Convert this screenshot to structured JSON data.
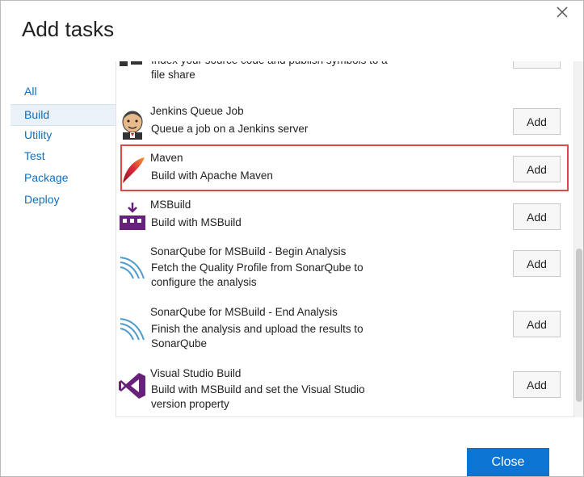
{
  "dialog": {
    "title": "Add tasks",
    "close_label": "Close"
  },
  "sidebar": {
    "items": [
      {
        "label": "All"
      },
      {
        "label": "Build",
        "selected": true
      },
      {
        "label": "Utility"
      },
      {
        "label": "Test"
      },
      {
        "label": "Package"
      },
      {
        "label": "Deploy"
      }
    ]
  },
  "tasks": [
    {
      "name": "",
      "description": "Index your source code and publish symbols to a file share",
      "description_lines": [
        "Index your source code and publish symbols to a",
        "file share"
      ],
      "icon": "index-sources-icon",
      "add_label": "Add"
    },
    {
      "name": "Jenkins Queue Job",
      "description": "Queue a job on a Jenkins server",
      "icon": "jenkins-icon",
      "add_label": "Add"
    },
    {
      "name": "Maven",
      "description": "Build with Apache Maven",
      "icon": "maven-feather-icon",
      "add_label": "Add",
      "highlighted": true
    },
    {
      "name": "MSBuild",
      "description": "Build with MSBuild",
      "icon": "msbuild-icon",
      "add_label": "Add"
    },
    {
      "name": "SonarQube for MSBuild - Begin Analysis",
      "description_lines": [
        "Fetch the Quality Profile from SonarQube to",
        "configure the analysis"
      ],
      "icon": "sonarqube-icon",
      "add_label": "Add"
    },
    {
      "name": "SonarQube for MSBuild - End Analysis",
      "description_lines": [
        "Finish the analysis and upload the results to",
        "SonarQube"
      ],
      "icon": "sonarqube-icon",
      "add_label": "Add"
    },
    {
      "name": "Visual Studio Build",
      "description_lines": [
        "Build with MSBuild and set the Visual Studio",
        "version property"
      ],
      "icon": "visual-studio-icon",
      "add_label": "Add"
    }
  ],
  "colors": {
    "accent": "#0c75d4",
    "link": "#106ebe",
    "highlight_border": "#e04848",
    "msbuild_purple": "#68217a",
    "vs_purple": "#68217a"
  }
}
